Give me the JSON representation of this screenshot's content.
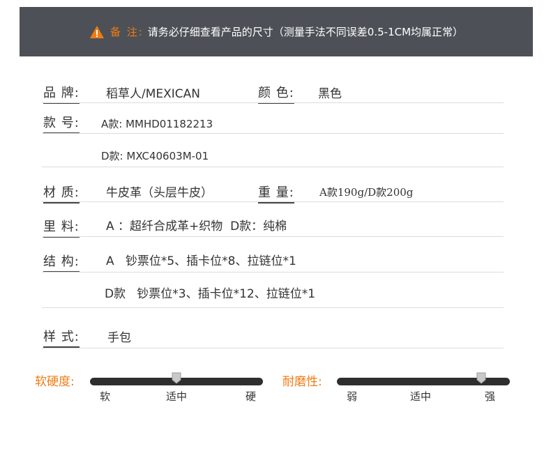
{
  "notice": {
    "prefix": "备 注:",
    "text": "请务必仔细查看产品的尺寸（测量手法不同误差0.5-1CM均属正常）"
  },
  "specs": {
    "brand_label": "品 牌:",
    "brand_value": "稻草人/MEXICAN",
    "color_label": "颜 色:",
    "color_value": "黑色",
    "model_label": "款 号:",
    "model_a": "A款: MMHD01182213",
    "model_d": "D款: MXC40603M-01",
    "material_label": "材 质:",
    "material_value": "牛皮革（头层牛皮）",
    "weight_label": "重 量:",
    "weight_value": "A款190g/D款200g",
    "lining_label": "里 料:",
    "lining_value": "A ：超纤合成革+织物  D款：纯棉",
    "structure_label": "结 构:",
    "structure_a": "A   钞票位*5、插卡位*8、拉链位*1",
    "structure_d": "D款   钞票位*3、插卡位*12、拉链位*1",
    "style_label": "样 式:",
    "style_value": "手包"
  },
  "sliders": {
    "softness": {
      "label": "软硬度:",
      "ticks": [
        "软",
        "适中",
        "硬"
      ],
      "level": 0.5
    },
    "durability": {
      "label": "耐磨性:",
      "ticks": [
        "弱",
        "适中",
        "强"
      ],
      "level": 0.9
    }
  },
  "colors": {
    "banner_bg": "#4d5157",
    "accent": "#f07b13",
    "track": "#2e2e2e"
  }
}
